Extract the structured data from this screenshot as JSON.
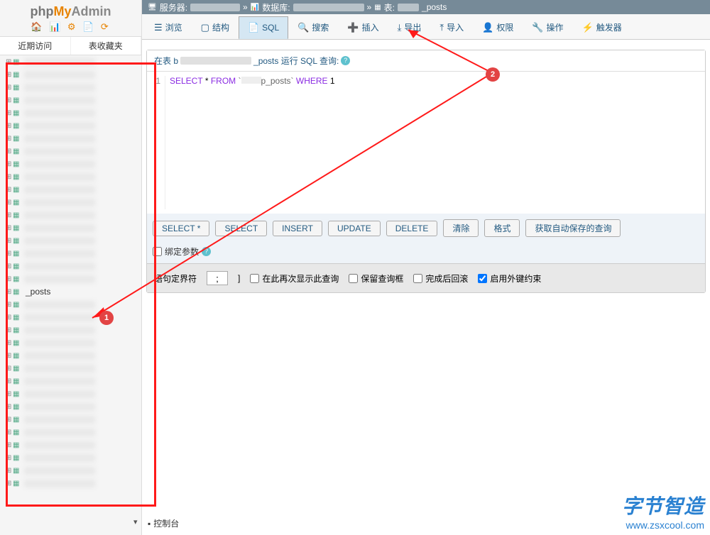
{
  "logo": {
    "php": "php",
    "my": "My",
    "admin": "Admin"
  },
  "sidebar_tabs": {
    "recent": "近期访问",
    "favorites": "表收藏夹"
  },
  "tree_items_count": 34,
  "posts_label": "_posts",
  "breadcrumb": {
    "server_label": "服务器:",
    "db_label": "数据库:",
    "table_label": "表:",
    "table_name": "_posts"
  },
  "tabs": {
    "browse": "浏览",
    "structure": "结构",
    "sql": "SQL",
    "search": "搜索",
    "insert": "插入",
    "export": "导出",
    "import": "导入",
    "privileges": "权限",
    "operations": "操作",
    "triggers": "触发器"
  },
  "sql": {
    "title_prefix": "在表 b",
    "title_suffix": "_posts 运行 SQL 查询:",
    "line_no": "1",
    "keyword_select": "SELECT",
    "star": "*",
    "keyword_from": "FROM",
    "table": "p_posts",
    "keyword_where": "WHERE",
    "cond": "1"
  },
  "buttons": {
    "select_all": "SELECT *",
    "select": "SELECT",
    "insert": "INSERT",
    "update": "UPDATE",
    "delete": "DELETE",
    "clear": "清除",
    "format": "格式",
    "autosave": "获取自动保存的查询"
  },
  "bind_params": "绑定参数",
  "options": {
    "delimiter_label": "语句定界符",
    "delimiter_value": ";",
    "after": "]",
    "show_again": "在此再次显示此查询",
    "retain": "保留查询框",
    "rollback": "完成后回滚",
    "fk": "启用外键约束",
    "fk_checked": true
  },
  "console_label": "控制台",
  "annotations": {
    "dot1": "1",
    "dot2": "2"
  },
  "watermark": {
    "big": "字节智造",
    "small": "www.zsxcool.com"
  }
}
